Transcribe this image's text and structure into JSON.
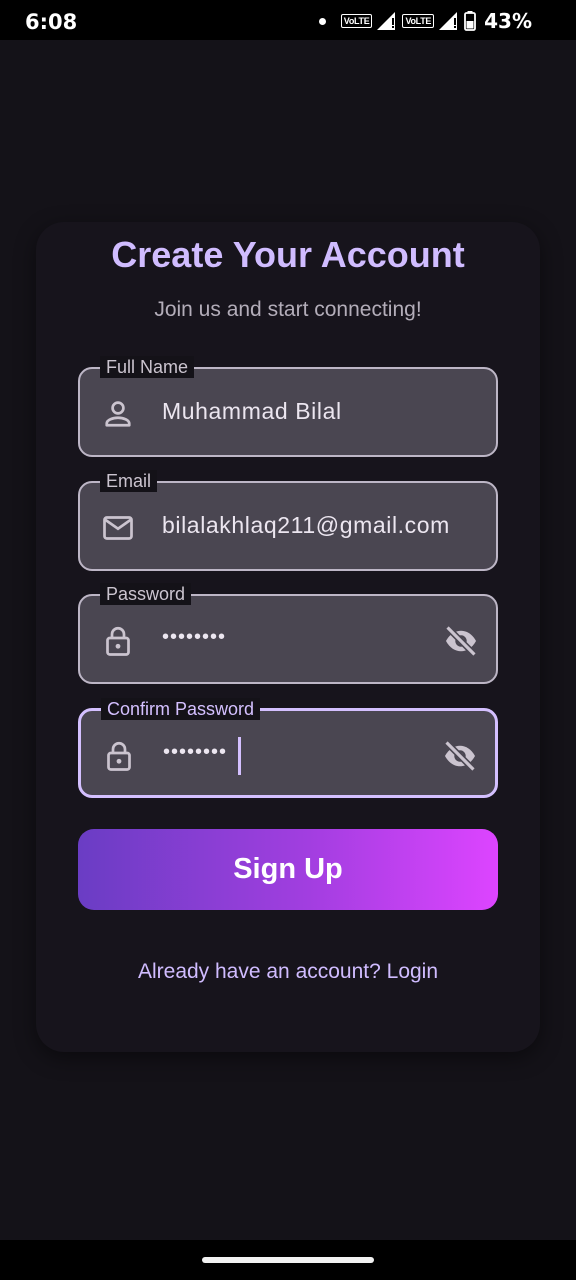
{
  "status_bar": {
    "time": "6:08",
    "network_badge_1": "VoLTE",
    "network_badge_2": "VoLTE",
    "battery_percent": "43%"
  },
  "form": {
    "title": "Create Your Account",
    "subtitle": "Join us and start connecting!",
    "fields": {
      "full_name": {
        "label": "Full Name",
        "value": "Muhammad Bilal",
        "icon": "person-icon"
      },
      "email": {
        "label": "Email",
        "value": "bilalakhlaq211@gmail.com",
        "icon": "mail-icon"
      },
      "password": {
        "label": "Password",
        "value": "••••••••",
        "icon": "lock-icon"
      },
      "confirm_password": {
        "label": "Confirm Password",
        "value": "••••••••",
        "icon": "lock-icon",
        "focused": true
      }
    },
    "signup_label": "Sign Up",
    "login_link": "Already have an account? Login"
  },
  "colors": {
    "background": "#141218",
    "accent": "#d0bcff",
    "field_fill": "#4a4651",
    "button_gradient_start": "#6a3dc4",
    "button_gradient_end": "#dd44ff"
  }
}
